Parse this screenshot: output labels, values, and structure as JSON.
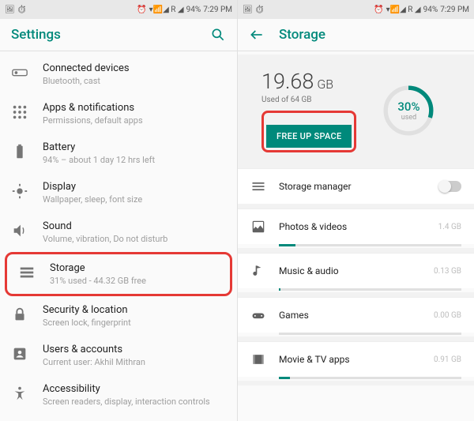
{
  "status": {
    "icons_left": "🖼 ⏱",
    "alarm": "⏰",
    "signal": "▾📶◢ R ◢",
    "batt": "94%",
    "time": "7:29 PM"
  },
  "left": {
    "title": "Settings",
    "items": [
      {
        "icon": "link",
        "label": "Connected devices",
        "sub": "Bluetooth, cast"
      },
      {
        "icon": "grid",
        "label": "Apps & notifications",
        "sub": "Permissions, default apps"
      },
      {
        "icon": "batt",
        "label": "Battery",
        "sub": "94% – about 1 day 12 hrs left"
      },
      {
        "icon": "bright",
        "label": "Display",
        "sub": "Wallpaper, sleep, font size"
      },
      {
        "icon": "sound",
        "label": "Sound",
        "sub": "Volume, vibration, Do not disturb"
      },
      {
        "icon": "storage",
        "label": "Storage",
        "sub": "31% used - 44.32 GB free",
        "hl": true
      },
      {
        "icon": "lock",
        "label": "Security & location",
        "sub": "Screen lock, fingerprint"
      },
      {
        "icon": "user",
        "label": "Users & accounts",
        "sub": "Current user: Akhil Mithran"
      },
      {
        "icon": "acc",
        "label": "Accessibility",
        "sub": "Screen readers, display, interaction controls"
      }
    ]
  },
  "right": {
    "title": "Storage",
    "used_value": "19.68",
    "used_unit": "GB",
    "used_of": "Used of 64 GB",
    "pct": "30%",
    "pct_label": "used",
    "pct_num": 30,
    "btn": "FREE UP SPACE",
    "mgr": "Storage manager",
    "cats": [
      {
        "icon": "photo",
        "label": "Photos & videos",
        "val": "1.4 GB",
        "bar": 9
      },
      {
        "icon": "music",
        "label": "Music & audio",
        "val": "0.13 GB",
        "bar": 1
      },
      {
        "icon": "game",
        "label": "Games",
        "val": "0.00 GB",
        "bar": 0
      },
      {
        "icon": "movie",
        "label": "Movie & TV apps",
        "val": "0.91 GB",
        "bar": 6
      }
    ]
  }
}
